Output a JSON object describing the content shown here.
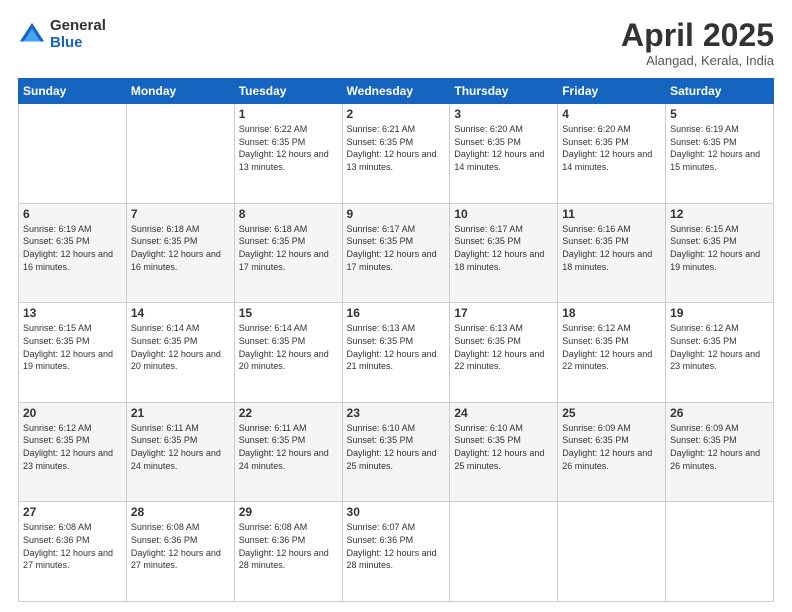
{
  "logo": {
    "general": "General",
    "blue": "Blue"
  },
  "header": {
    "title": "April 2025",
    "subtitle": "Alangad, Kerala, India"
  },
  "days_of_week": [
    "Sunday",
    "Monday",
    "Tuesday",
    "Wednesday",
    "Thursday",
    "Friday",
    "Saturday"
  ],
  "weeks": [
    [
      {
        "day": "",
        "sunrise": "",
        "sunset": "",
        "daylight": ""
      },
      {
        "day": "",
        "sunrise": "",
        "sunset": "",
        "daylight": ""
      },
      {
        "day": "1",
        "sunrise": "Sunrise: 6:22 AM",
        "sunset": "Sunset: 6:35 PM",
        "daylight": "Daylight: 12 hours and 13 minutes."
      },
      {
        "day": "2",
        "sunrise": "Sunrise: 6:21 AM",
        "sunset": "Sunset: 6:35 PM",
        "daylight": "Daylight: 12 hours and 13 minutes."
      },
      {
        "day": "3",
        "sunrise": "Sunrise: 6:20 AM",
        "sunset": "Sunset: 6:35 PM",
        "daylight": "Daylight: 12 hours and 14 minutes."
      },
      {
        "day": "4",
        "sunrise": "Sunrise: 6:20 AM",
        "sunset": "Sunset: 6:35 PM",
        "daylight": "Daylight: 12 hours and 14 minutes."
      },
      {
        "day": "5",
        "sunrise": "Sunrise: 6:19 AM",
        "sunset": "Sunset: 6:35 PM",
        "daylight": "Daylight: 12 hours and 15 minutes."
      }
    ],
    [
      {
        "day": "6",
        "sunrise": "Sunrise: 6:19 AM",
        "sunset": "Sunset: 6:35 PM",
        "daylight": "Daylight: 12 hours and 16 minutes."
      },
      {
        "day": "7",
        "sunrise": "Sunrise: 6:18 AM",
        "sunset": "Sunset: 6:35 PM",
        "daylight": "Daylight: 12 hours and 16 minutes."
      },
      {
        "day": "8",
        "sunrise": "Sunrise: 6:18 AM",
        "sunset": "Sunset: 6:35 PM",
        "daylight": "Daylight: 12 hours and 17 minutes."
      },
      {
        "day": "9",
        "sunrise": "Sunrise: 6:17 AM",
        "sunset": "Sunset: 6:35 PM",
        "daylight": "Daylight: 12 hours and 17 minutes."
      },
      {
        "day": "10",
        "sunrise": "Sunrise: 6:17 AM",
        "sunset": "Sunset: 6:35 PM",
        "daylight": "Daylight: 12 hours and 18 minutes."
      },
      {
        "day": "11",
        "sunrise": "Sunrise: 6:16 AM",
        "sunset": "Sunset: 6:35 PM",
        "daylight": "Daylight: 12 hours and 18 minutes."
      },
      {
        "day": "12",
        "sunrise": "Sunrise: 6:15 AM",
        "sunset": "Sunset: 6:35 PM",
        "daylight": "Daylight: 12 hours and 19 minutes."
      }
    ],
    [
      {
        "day": "13",
        "sunrise": "Sunrise: 6:15 AM",
        "sunset": "Sunset: 6:35 PM",
        "daylight": "Daylight: 12 hours and 19 minutes."
      },
      {
        "day": "14",
        "sunrise": "Sunrise: 6:14 AM",
        "sunset": "Sunset: 6:35 PM",
        "daylight": "Daylight: 12 hours and 20 minutes."
      },
      {
        "day": "15",
        "sunrise": "Sunrise: 6:14 AM",
        "sunset": "Sunset: 6:35 PM",
        "daylight": "Daylight: 12 hours and 20 minutes."
      },
      {
        "day": "16",
        "sunrise": "Sunrise: 6:13 AM",
        "sunset": "Sunset: 6:35 PM",
        "daylight": "Daylight: 12 hours and 21 minutes."
      },
      {
        "day": "17",
        "sunrise": "Sunrise: 6:13 AM",
        "sunset": "Sunset: 6:35 PM",
        "daylight": "Daylight: 12 hours and 22 minutes."
      },
      {
        "day": "18",
        "sunrise": "Sunrise: 6:12 AM",
        "sunset": "Sunset: 6:35 PM",
        "daylight": "Daylight: 12 hours and 22 minutes."
      },
      {
        "day": "19",
        "sunrise": "Sunrise: 6:12 AM",
        "sunset": "Sunset: 6:35 PM",
        "daylight": "Daylight: 12 hours and 23 minutes."
      }
    ],
    [
      {
        "day": "20",
        "sunrise": "Sunrise: 6:12 AM",
        "sunset": "Sunset: 6:35 PM",
        "daylight": "Daylight: 12 hours and 23 minutes."
      },
      {
        "day": "21",
        "sunrise": "Sunrise: 6:11 AM",
        "sunset": "Sunset: 6:35 PM",
        "daylight": "Daylight: 12 hours and 24 minutes."
      },
      {
        "day": "22",
        "sunrise": "Sunrise: 6:11 AM",
        "sunset": "Sunset: 6:35 PM",
        "daylight": "Daylight: 12 hours and 24 minutes."
      },
      {
        "day": "23",
        "sunrise": "Sunrise: 6:10 AM",
        "sunset": "Sunset: 6:35 PM",
        "daylight": "Daylight: 12 hours and 25 minutes."
      },
      {
        "day": "24",
        "sunrise": "Sunrise: 6:10 AM",
        "sunset": "Sunset: 6:35 PM",
        "daylight": "Daylight: 12 hours and 25 minutes."
      },
      {
        "day": "25",
        "sunrise": "Sunrise: 6:09 AM",
        "sunset": "Sunset: 6:35 PM",
        "daylight": "Daylight: 12 hours and 26 minutes."
      },
      {
        "day": "26",
        "sunrise": "Sunrise: 6:09 AM",
        "sunset": "Sunset: 6:35 PM",
        "daylight": "Daylight: 12 hours and 26 minutes."
      }
    ],
    [
      {
        "day": "27",
        "sunrise": "Sunrise: 6:08 AM",
        "sunset": "Sunset: 6:36 PM",
        "daylight": "Daylight: 12 hours and 27 minutes."
      },
      {
        "day": "28",
        "sunrise": "Sunrise: 6:08 AM",
        "sunset": "Sunset: 6:36 PM",
        "daylight": "Daylight: 12 hours and 27 minutes."
      },
      {
        "day": "29",
        "sunrise": "Sunrise: 6:08 AM",
        "sunset": "Sunset: 6:36 PM",
        "daylight": "Daylight: 12 hours and 28 minutes."
      },
      {
        "day": "30",
        "sunrise": "Sunrise: 6:07 AM",
        "sunset": "Sunset: 6:36 PM",
        "daylight": "Daylight: 12 hours and 28 minutes."
      },
      {
        "day": "",
        "sunrise": "",
        "sunset": "",
        "daylight": ""
      },
      {
        "day": "",
        "sunrise": "",
        "sunset": "",
        "daylight": ""
      },
      {
        "day": "",
        "sunrise": "",
        "sunset": "",
        "daylight": ""
      }
    ]
  ]
}
